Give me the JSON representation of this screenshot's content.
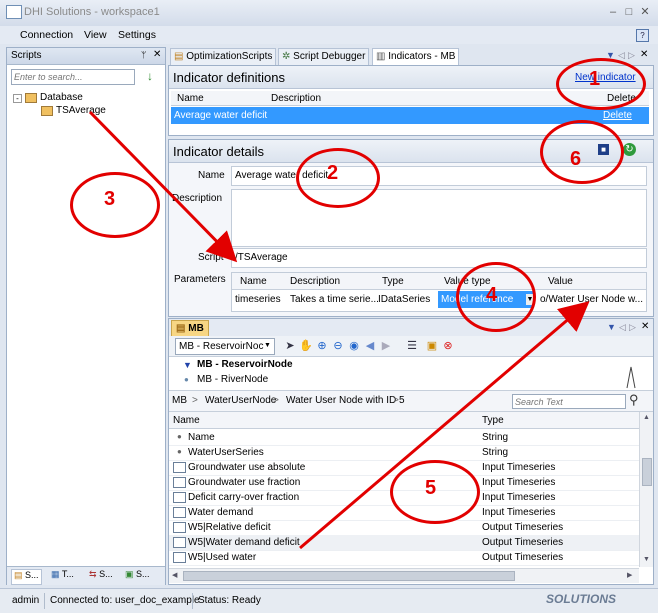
{
  "window": {
    "title": "DHI Solutions - workspace1"
  },
  "menu": [
    "Connection",
    "View",
    "Settings"
  ],
  "scripts_panel": {
    "title": "Scripts",
    "search_placeholder": "Enter to search...",
    "tree": [
      {
        "label": "Database",
        "level": 0
      },
      {
        "label": "TSAverage",
        "level": 1
      }
    ],
    "bottom_tabs": [
      "S...",
      "T...",
      "S...",
      "S..."
    ]
  },
  "main_tabs": [
    "OptimizationScripts",
    "Script Debugger",
    "Indicators - MB"
  ],
  "definitions": {
    "title": "Indicator definitions",
    "new_link": "New indicator",
    "columns": [
      "Name",
      "Description",
      "Delete"
    ],
    "rows": [
      {
        "name": "Average water deficit",
        "description": "",
        "delete": "Delete"
      }
    ]
  },
  "details": {
    "title": "Indicator details",
    "name_label": "Name",
    "name_value": "Average water deficit",
    "description_label": "Description",
    "description_value": "",
    "script_label": "Script",
    "script_value": "/TSAverage",
    "parameters_label": "Parameters",
    "param_columns": [
      "Name",
      "Description",
      "Type",
      "Value type",
      "Value"
    ],
    "params": [
      {
        "name": "timeseries",
        "description": "Takes a time serie...",
        "type": "IDataSeries",
        "value_type": "Model reference",
        "value": "o/Water User Node w..."
      }
    ]
  },
  "mb": {
    "tab_label": "MB",
    "dropdown_value": "MB - ReservoirNoc",
    "nodes": [
      "MB - ReservoirNode",
      "MB - RiverNode"
    ],
    "breadcrumb": [
      "MB",
      "WaterUserNode",
      "Water User Node with ID 5"
    ],
    "search_placeholder": "Search Text",
    "columns": [
      "Name",
      "Type"
    ],
    "rows": [
      {
        "name": "Name",
        "type": "String",
        "icon": "bullet"
      },
      {
        "name": "WaterUserSeries",
        "type": "String",
        "icon": "bullet"
      },
      {
        "name": "Groundwater use absolute",
        "type": "Input Timeseries",
        "icon": "chart"
      },
      {
        "name": "Groundwater use fraction",
        "type": "Input Timeseries",
        "icon": "chart"
      },
      {
        "name": "Deficit carry-over fraction",
        "type": "Input Timeseries",
        "icon": "chart"
      },
      {
        "name": "Water demand",
        "type": "Input Timeseries",
        "icon": "chart"
      },
      {
        "name": "W5|Relative deficit",
        "type": "Output Timeseries",
        "icon": "chart"
      },
      {
        "name": "W5|Water demand deficit",
        "type": "Output Timeseries",
        "icon": "chart"
      },
      {
        "name": "W5|Used water",
        "type": "Output Timeseries",
        "icon": "chart"
      }
    ]
  },
  "status": {
    "user": "admin",
    "connection": "Connected to: user_doc_example",
    "state": "Status: Ready",
    "brand": "SOLUTIONS"
  },
  "annotations": [
    "1",
    "2",
    "3",
    "4",
    "5",
    "6"
  ],
  "colors": {
    "accent": "#3399ff",
    "annotation": "#e20000"
  }
}
